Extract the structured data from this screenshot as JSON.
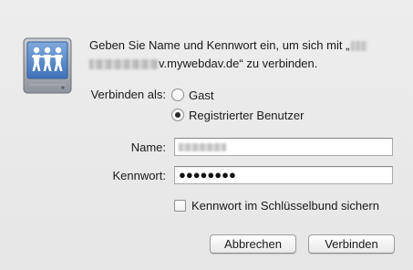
{
  "message": {
    "line1_prefix": "Geben Sie Name und Kennwort ein, um sich mit „",
    "line2_suffix": "v.mywebdav.de“ zu verbinden."
  },
  "connect_as": {
    "label": "Verbinden als:",
    "options": [
      "Gast",
      "Registrierter Benutzer"
    ],
    "selected": "Registrierter Benutzer"
  },
  "name_field": {
    "label": "Name:",
    "value": ""
  },
  "password_field": {
    "label": "Kennwort:",
    "masked_value": "●●●●●●●●"
  },
  "keychain_checkbox": {
    "label": "Kennwort im Schlüsselbund sichern",
    "checked": false
  },
  "buttons": {
    "cancel": "Abbrechen",
    "connect": "Verbinden"
  },
  "icons": {
    "server": "shared-server-icon"
  }
}
